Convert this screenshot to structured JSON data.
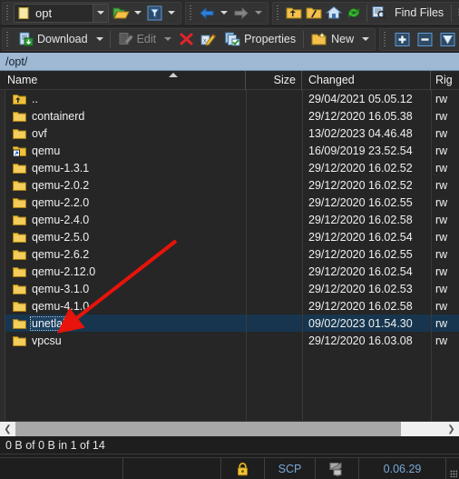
{
  "window": {
    "remote_path_combo": "opt",
    "path_bar": "/opt/"
  },
  "toolbar_top": {
    "open_dir_icon": "open-folder-icon",
    "filter_icon": "filter-icon",
    "back_icon": "back-arrow-icon",
    "forward_icon": "forward-arrow-icon",
    "parent_icon": "parent-folder-icon",
    "root_icon": "root-folder-icon",
    "home_icon": "home-icon",
    "refresh_icon": "refresh-icon",
    "find_files_label": "Find Files",
    "bookmark_icon": "bookmark-folder-icon"
  },
  "toolbar_second": {
    "download_label": "Download",
    "edit_label": "Edit",
    "delete_icon": "delete-x-icon",
    "rename_icon": "rename-icon",
    "properties_label": "Properties",
    "new_label": "New",
    "select_plus_icon": "select-plus-icon",
    "select_minus_icon": "select-minus-icon",
    "select_invert_icon": "select-invert-icon"
  },
  "columns": {
    "name": "Name",
    "size": "Size",
    "changed": "Changed",
    "rights": "Rig"
  },
  "files": [
    {
      "name": "..",
      "icon": "parent-folder-icon",
      "size": "",
      "changed": "29/04/2021 05.05.12",
      "rights": "rw",
      "selected": false
    },
    {
      "name": "containerd",
      "icon": "folder-icon",
      "size": "",
      "changed": "29/12/2020 16.05.38",
      "rights": "rw",
      "selected": false
    },
    {
      "name": "ovf",
      "icon": "folder-icon",
      "size": "",
      "changed": "13/02/2023 04.46.48",
      "rights": "rw",
      "selected": false
    },
    {
      "name": "qemu",
      "icon": "folder-link-icon",
      "size": "",
      "changed": "16/09/2019 23.52.54",
      "rights": "rw",
      "selected": false
    },
    {
      "name": "qemu-1.3.1",
      "icon": "folder-icon",
      "size": "",
      "changed": "29/12/2020 16.02.52",
      "rights": "rw",
      "selected": false
    },
    {
      "name": "qemu-2.0.2",
      "icon": "folder-icon",
      "size": "",
      "changed": "29/12/2020 16.02.52",
      "rights": "rw",
      "selected": false
    },
    {
      "name": "qemu-2.2.0",
      "icon": "folder-icon",
      "size": "",
      "changed": "29/12/2020 16.02.55",
      "rights": "rw",
      "selected": false
    },
    {
      "name": "qemu-2.4.0",
      "icon": "folder-icon",
      "size": "",
      "changed": "29/12/2020 16.02.58",
      "rights": "rw",
      "selected": false
    },
    {
      "name": "qemu-2.5.0",
      "icon": "folder-icon",
      "size": "",
      "changed": "29/12/2020 16.02.54",
      "rights": "rw",
      "selected": false
    },
    {
      "name": "qemu-2.6.2",
      "icon": "folder-icon",
      "size": "",
      "changed": "29/12/2020 16.02.55",
      "rights": "rw",
      "selected": false
    },
    {
      "name": "qemu-2.12.0",
      "icon": "folder-icon",
      "size": "",
      "changed": "29/12/2020 16.02.54",
      "rights": "rw",
      "selected": false
    },
    {
      "name": "qemu-3.1.0",
      "icon": "folder-icon",
      "size": "",
      "changed": "29/12/2020 16.02.53",
      "rights": "rw",
      "selected": false
    },
    {
      "name": "qemu-4.1.0",
      "icon": "folder-icon",
      "size": "",
      "changed": "29/12/2020 16.02.58",
      "rights": "rw",
      "selected": false
    },
    {
      "name": "unetlab",
      "icon": "folder-icon",
      "size": "",
      "changed": "09/02/2023 01.54.30",
      "rights": "rw",
      "selected": true
    },
    {
      "name": "vpcsu",
      "icon": "folder-icon",
      "size": "",
      "changed": "29/12/2020 16.03.08",
      "rights": "rw",
      "selected": false
    }
  ],
  "selection_status": "0 B of 0 B in 1 of 14",
  "statusbar": {
    "lock_icon": "padlock-icon",
    "protocol": "SCP",
    "network_icon": "network-transfer-icon",
    "elapsed": "0.06.29"
  },
  "annotation": {
    "arrow_color": "#e8130a",
    "target": "unetlab"
  },
  "colors": {
    "accent_blue": "#9fb8d4",
    "selection": "#17354f",
    "folder_yellow": "#f5c14b",
    "status_text": "#7aa8d8"
  }
}
